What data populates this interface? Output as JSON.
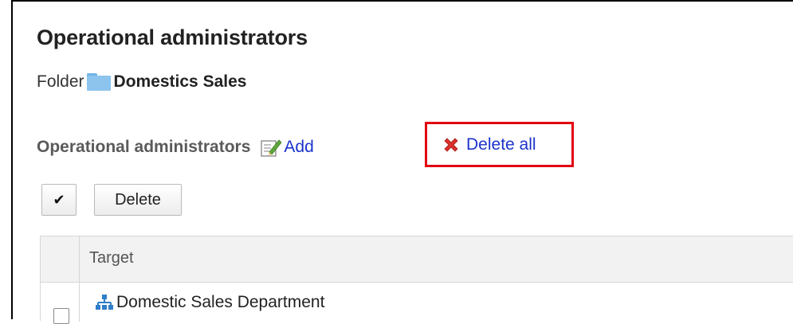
{
  "page": {
    "title": "Operational administrators",
    "folder_label": "Folder",
    "folder_name": "Domestics Sales"
  },
  "section": {
    "title": "Operational administrators",
    "add_label": "Add",
    "delete_all_label": "Delete all",
    "highlight_color": "#e3000f",
    "link_color": "#1a33cc"
  },
  "toolbar": {
    "select_all_label": "✔",
    "delete_label": "Delete"
  },
  "table": {
    "columns": [
      "Target"
    ],
    "rows": [
      {
        "icon": "organization-icon",
        "target": "Domestic Sales Department"
      }
    ]
  },
  "icons": {
    "folder": "folder-icon",
    "add": "edit-note-icon",
    "delete_all": "red-x-icon",
    "row": "organization-icon"
  }
}
